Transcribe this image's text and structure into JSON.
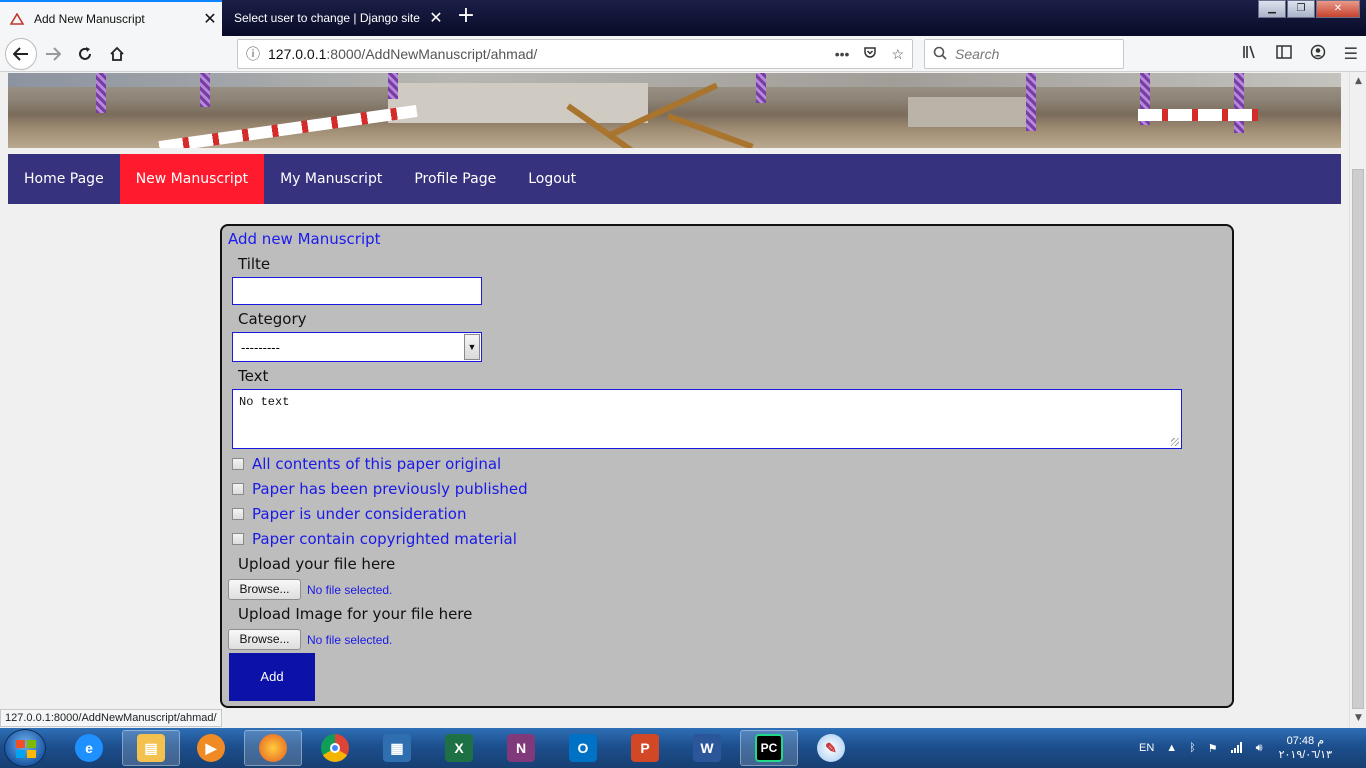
{
  "browser": {
    "tabs": [
      {
        "title": "Add New Manuscript",
        "active": true
      },
      {
        "title": "Select user to change | Django site",
        "active": false
      }
    ],
    "url": {
      "host": "127.0.0.1",
      "rest": ":8000/AddNewManuscript/ahmad/"
    },
    "search_placeholder": "Search",
    "status_url": "127.0.0.1:8000/AddNewManuscript/ahmad/"
  },
  "menu": {
    "items": [
      "Home Page",
      "New Manuscript",
      "My Manuscript",
      "Profile Page",
      "Logout"
    ],
    "active_index": 1,
    "colors": {
      "bar": "#36327e",
      "active": "#ff1b2d"
    }
  },
  "form": {
    "heading": "Add new Manuscript",
    "title_label": "Tilte",
    "title_value": "",
    "category_label": "Category",
    "category_selected": "---------",
    "text_label": "Text",
    "text_value": "No text",
    "checkboxes": [
      {
        "label": "All contents of this paper original",
        "checked": false
      },
      {
        "label": "Paper has been previously published",
        "checked": false
      },
      {
        "label": "Paper is under consideration",
        "checked": false
      },
      {
        "label": "Paper contain copyrighted material",
        "checked": false
      }
    ],
    "upload_file_label": "Upload your file here",
    "upload_image_label": "Upload Image for your file here",
    "browse_label": "Browse...",
    "no_file": "No file selected.",
    "submit_label": "Add"
  },
  "taskbar": {
    "apps": [
      "Internet Explorer",
      "File Explorer",
      "Media Player",
      "Firefox",
      "Chrome",
      "Server Manager",
      "Excel",
      "OneNote",
      "Outlook",
      "PowerPoint",
      "Word",
      "PyCharm",
      "Paint"
    ],
    "language": "EN",
    "time": "07:48 م",
    "date": "٢٠١٩/٠٦/١٣"
  }
}
